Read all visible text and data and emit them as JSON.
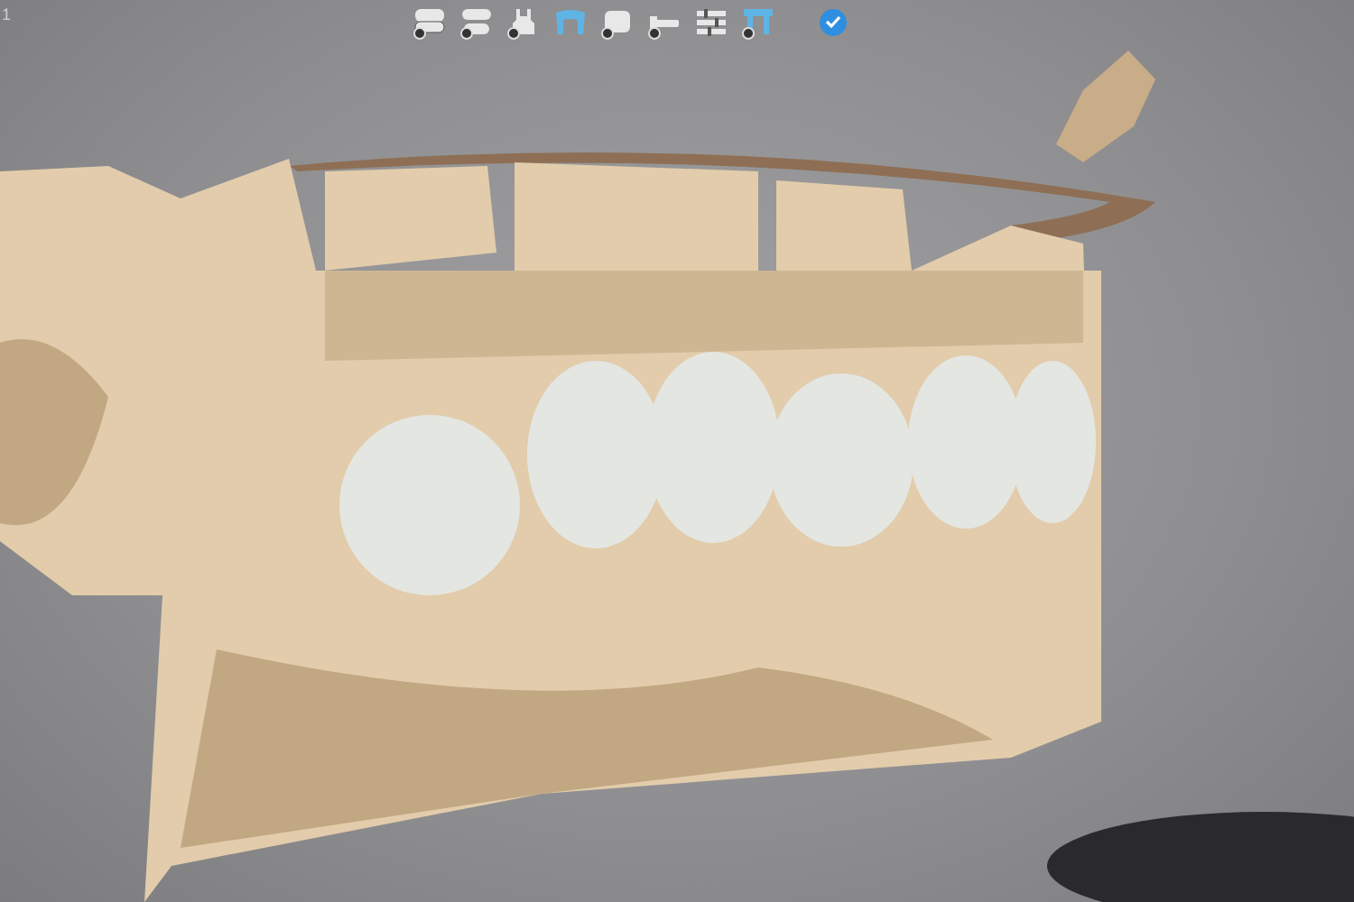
{
  "corner_label": "1",
  "toolbar": {
    "tools": [
      {
        "kind": "jaw-closed",
        "selected": false,
        "toggle": true
      },
      {
        "kind": "jaw-open",
        "selected": false,
        "toggle": true
      },
      {
        "kind": "tooth",
        "selected": false,
        "toggle": true
      },
      {
        "kind": "crown",
        "selected": true,
        "toggle": false
      },
      {
        "kind": "block",
        "selected": false,
        "toggle": true
      },
      {
        "kind": "bar",
        "selected": false,
        "toggle": true
      },
      {
        "kind": "sliders",
        "selected": false,
        "toggle": false
      },
      {
        "kind": "bridge",
        "selected": true,
        "toggle": true
      }
    ],
    "confirm": {
      "kind": "check"
    }
  }
}
